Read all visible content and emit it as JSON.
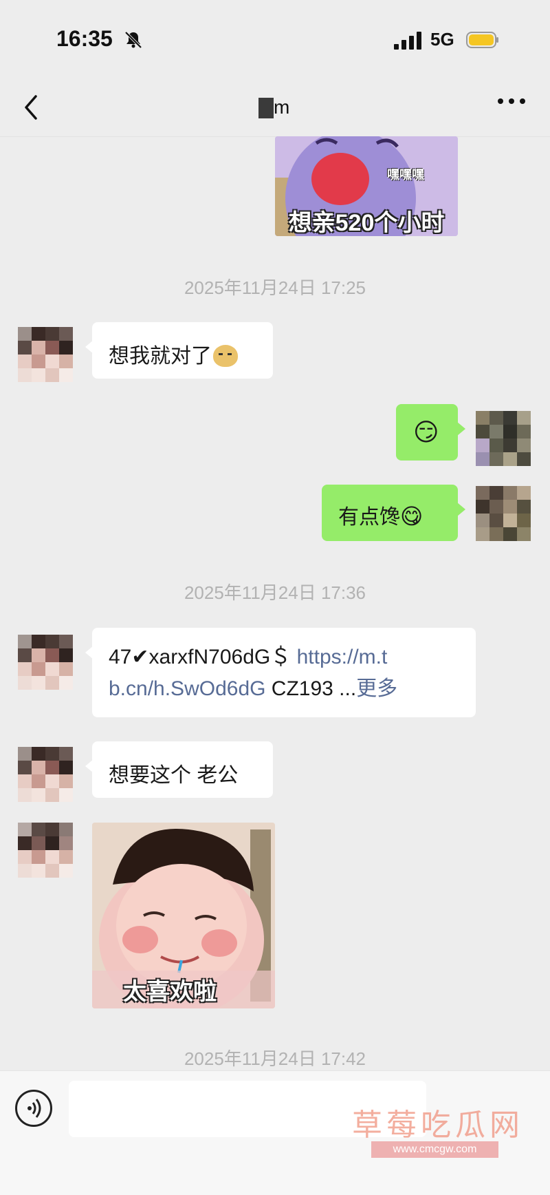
{
  "status_bar": {
    "time": "16:35",
    "network": "5G"
  },
  "chat": {
    "title": "m"
  },
  "timestamps": [
    "2025年11月24日 17:25",
    "2025年11月24日 17:36",
    "2025年11月24日 17:42"
  ],
  "messages": {
    "top_sticker_caption": "想亲520个小时",
    "top_sticker_small_text": "嘿嘿嘿",
    "m1": "想我就对了",
    "m2_emoji": "😏",
    "m3": "有点馋",
    "m3_emoji": "😋",
    "m4_code": "47✔xarxfN706dG＄",
    "m4_url_1": "https://m.t",
    "m4_url_2": "b.cn/h.SwOd6dG",
    "m4_tail": " CZ193 ...",
    "m4_more": "更多",
    "m5": "想要这个 老公",
    "bottom_sticker_caption": "太喜欢啦"
  },
  "watermark": {
    "text": "草莓吃瓜网",
    "url": "www.cmcgw.com"
  },
  "colors": {
    "bg": "#ededed",
    "green_bubble": "#95ec69",
    "link": "#576b95",
    "timestamp": "#b2b2b2",
    "battery": "#f5c623"
  }
}
